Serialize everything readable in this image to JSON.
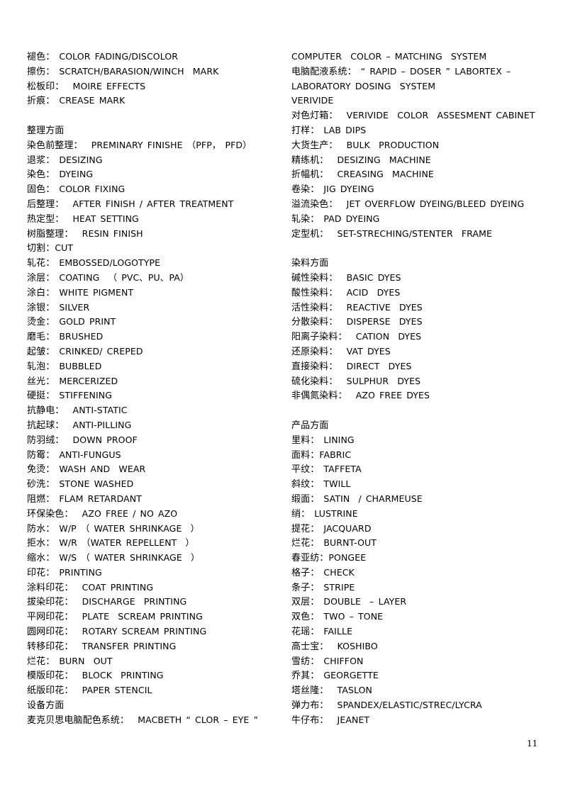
{
  "left_column": [
    {
      "zh": "褪色：",
      "en": " COLOR FADING/DISCOLOR"
    },
    {
      "zh": "擦伤：",
      "en": " SCRATCH/BARASION/WINCH  MARK"
    },
    {
      "zh": "松板印：",
      "en": "  MOIRE EFFECTS"
    },
    {
      "zh": "折痕：",
      "en": " CREASE MARK"
    },
    {
      "blank": true
    },
    {
      "zh": "整理方面",
      "en": ""
    },
    {
      "zh": "染色前整理：",
      "en": "  PREMINARY FINISHE （PFP， PFD）"
    },
    {
      "zh": "退浆：",
      "en": " DESIZING"
    },
    {
      "zh": "染色：",
      "en": " DYEING"
    },
    {
      "zh": "固色：",
      "en": " COLOR FIXING"
    },
    {
      "zh": "后整理：",
      "en": "  AFTER FINISH / AFTER TREATMENT"
    },
    {
      "zh": "热定型：",
      "en": "  HEAT SETTING"
    },
    {
      "zh": "树脂整理：",
      "en": "  RESIN FINISH"
    },
    {
      "zh": "切割：",
      "en": "CUT"
    },
    {
      "zh": "轧花：",
      "en": " EMBOSSED/LOGOTYPE"
    },
    {
      "zh": "涂层：",
      "en": " COATING  （ PVC、PU、PA）"
    },
    {
      "zh": "涂白：",
      "en": " WHITE PIGMENT"
    },
    {
      "zh": "涂银：",
      "en": " SILVER"
    },
    {
      "zh": "烫金：",
      "en": " GOLD PRINT"
    },
    {
      "zh": "磨毛：",
      "en": " BRUSHED"
    },
    {
      "zh": "起皱：",
      "en": " CRINKED/ CREPED"
    },
    {
      "zh": "轧泡：",
      "en": " BUBBLED"
    },
    {
      "zh": "丝光：",
      "en": " MERCERIZED"
    },
    {
      "zh": "硬挺：",
      "en": " STIFFENING"
    },
    {
      "zh": "抗静电：",
      "en": "  ANTI-STATIC"
    },
    {
      "zh": "抗起球：",
      "en": "  ANTI-PILLING"
    },
    {
      "zh": "防羽绒：",
      "en": "  DOWN PROOF"
    },
    {
      "zh": "防霉：",
      "en": " ANTI-FUNGUS"
    },
    {
      "zh": "免烫：",
      "en": " WASH AND  WEAR"
    },
    {
      "zh": "砂洗：",
      "en": " STONE WASHED"
    },
    {
      "zh": "阻燃：",
      "en": " FLAM RETARDANT"
    },
    {
      "zh": "环保染色：",
      "en": "  AZO FREE / NO AZO"
    },
    {
      "zh": "防水：",
      "en": " W/P （ WATER SHRINKAGE  ）"
    },
    {
      "zh": "拒水：",
      "en": " W/R （WATER REPELLENT  ）"
    },
    {
      "zh": "缩水：",
      "en": " W/S （ WATER SHRINKAGE  ）"
    },
    {
      "zh": "印花：",
      "en": " PRINTING"
    },
    {
      "zh": "涂料印花：",
      "en": "  COAT PRINTING"
    },
    {
      "zh": "拔染印花：",
      "en": "  DISCHARGE  PRINTING"
    },
    {
      "zh": "平网印花：",
      "en": "  PLATE  SCREAM PRINTING"
    },
    {
      "zh": "圆网印花：",
      "en": "  ROTARY SCREAM PRINTING"
    },
    {
      "zh": "转移印花：",
      "en": "  TRANSFER PRINTING"
    },
    {
      "zh": "烂花：",
      "en": " BURN  OUT"
    },
    {
      "zh": "模版印花：",
      "en": "  BLOCK  PRINTING"
    },
    {
      "zh": "纸版印花：",
      "en": "  PAPER STENCIL"
    },
    {
      "zh": "设备方面",
      "en": ""
    },
    {
      "zh": "麦克贝思电脑配色系统：",
      "en": "  MACBETH “ CLOR – EYE ”"
    }
  ],
  "right_column": [
    {
      "zh": "",
      "en": "COMPUTER  COLOR – MATCHING  SYSTEM"
    },
    {
      "zh": "电脑配液系统：",
      "en": " “ RAPID – DOSER ” LABORTEX –"
    },
    {
      "zh": "",
      "en": "LABORATORY DOSING  SYSTEM"
    },
    {
      "zh": "",
      "en": "VERIVIDE"
    },
    {
      "zh": "对色灯箱：",
      "en": "  VERIVIDE  COLOR  ASSESMENT CABINET"
    },
    {
      "zh": "打样：",
      "en": " LAB DIPS"
    },
    {
      "zh": "大货生产：",
      "en": "  BULK  PRODUCTION"
    },
    {
      "zh": "精练机：",
      "en": "  DESIZING  MACHINE"
    },
    {
      "zh": "折幅机：",
      "en": "  CREASING  MACHINE"
    },
    {
      "zh": "卷染：",
      "en": " JIG DYEING"
    },
    {
      "zh": "溢流染色：",
      "en": "  JET OVERFLOW DYEING/BLEED DYEING"
    },
    {
      "zh": "轧染：",
      "en": " PAD DYEING"
    },
    {
      "zh": "定型机：",
      "en": "  SET-STRECHING/STENTER  FRAME"
    },
    {
      "blank": true
    },
    {
      "zh": "染料方面",
      "en": ""
    },
    {
      "zh": "碱性染料：",
      "en": "  BASIC DYES"
    },
    {
      "zh": "酸性染料：",
      "en": "  ACID  DYES"
    },
    {
      "zh": "活性染料：",
      "en": "  REACTIVE  DYES"
    },
    {
      "zh": "分散染料：",
      "en": "  DISPERSE  DYES"
    },
    {
      "zh": "阳离子染料：",
      "en": "  CATION  DYES"
    },
    {
      "zh": "还原染料：",
      "en": "  VAT DYES"
    },
    {
      "zh": "直接染料：",
      "en": "  DIRECT  DYES"
    },
    {
      "zh": "硫化染料：",
      "en": "  SULPHUR  DYES"
    },
    {
      "zh": "非偶氮染料：",
      "en": "  AZO FREE DYES"
    },
    {
      "blank": true
    },
    {
      "zh": "产品方面",
      "en": ""
    },
    {
      "zh": "里料：",
      "en": " LINING"
    },
    {
      "zh": "面料：",
      "en": "FABRIC"
    },
    {
      "zh": "平纹：",
      "en": " TAFFETA"
    },
    {
      "zh": "斜纹：",
      "en": " TWILL"
    },
    {
      "zh": "缎面：",
      "en": " SATIN  / CHARMEUSE"
    },
    {
      "zh": "绡：",
      "en": " LUSTRINE"
    },
    {
      "zh": "提花：",
      "en": " JACQUARD"
    },
    {
      "zh": "烂花：",
      "en": " BURNT-OUT"
    },
    {
      "zh": "春亚纺：",
      "en": "PONGEE"
    },
    {
      "zh": "格子：",
      "en": " CHECK"
    },
    {
      "zh": "条子：",
      "en": " STRIPE"
    },
    {
      "zh": "双层：",
      "en": " DOUBLE  – LAYER"
    },
    {
      "zh": "双色：",
      "en": " TWO – TONE"
    },
    {
      "zh": "花瑶：",
      "en": " FAILLE"
    },
    {
      "zh": "高士宝：",
      "en": "  KOSHIBO"
    },
    {
      "zh": "雪纺：",
      "en": " CHIFFON"
    },
    {
      "zh": "乔其：",
      "en": " GEORGETTE"
    },
    {
      "zh": "塔丝隆：",
      "en": "  TASLON"
    },
    {
      "zh": "弹力布：",
      "en": "  SPANDEX/ELASTIC/STREC/LYCRA"
    },
    {
      "zh": "牛仔布：",
      "en": "  JEANET"
    }
  ],
  "page_number": "11"
}
